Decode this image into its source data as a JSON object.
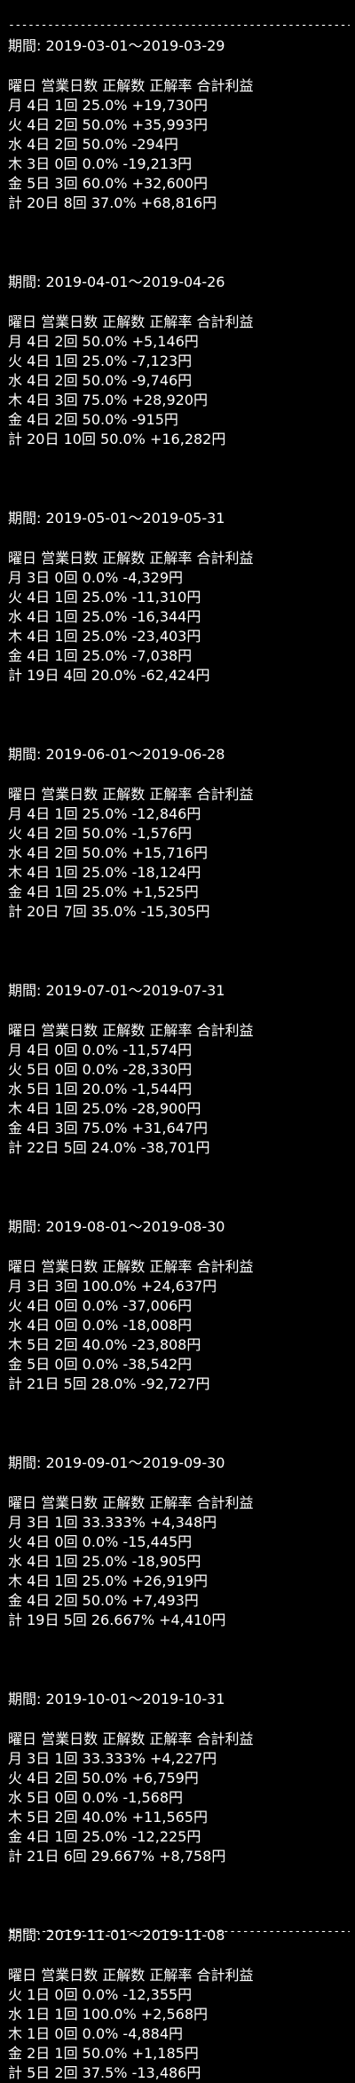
{
  "divider": "------------------------------------------------------",
  "period_label": "期間:",
  "header": [
    "曜日",
    "営業日数",
    "正解数",
    "正解率",
    "合計利益"
  ],
  "blocks": [
    {
      "period": "2019-03-01～2019-03-29",
      "rows": [
        [
          "月",
          "4日",
          "1回",
          "25.0%",
          "+19,730円"
        ],
        [
          "火",
          "4日",
          "2回",
          "50.0%",
          "+35,993円"
        ],
        [
          "水",
          "4日",
          "2回",
          "50.0%",
          "-294円"
        ],
        [
          "木",
          "3日",
          "0回",
          "0.0%",
          "-19,213円"
        ],
        [
          "金",
          "5日",
          "3回",
          "60.0%",
          "+32,600円"
        ],
        [
          "計",
          "20日",
          "8回",
          "37.0%",
          "+68,816円"
        ]
      ]
    },
    {
      "period": "2019-04-01～2019-04-26",
      "rows": [
        [
          "月",
          "4日",
          "2回",
          "50.0%",
          "+5,146円"
        ],
        [
          "火",
          "4日",
          "1回",
          "25.0%",
          "-7,123円"
        ],
        [
          "水",
          "4日",
          "2回",
          "50.0%",
          "-9,746円"
        ],
        [
          "木",
          "4日",
          "3回",
          "75.0%",
          "+28,920円"
        ],
        [
          "金",
          "4日",
          "2回",
          "50.0%",
          "-915円"
        ],
        [
          "計",
          "20日",
          "10回",
          "50.0%",
          "+16,282円"
        ]
      ]
    },
    {
      "period": "2019-05-01～2019-05-31",
      "rows": [
        [
          "月",
          "3日",
          "0回",
          "0.0%",
          "-4,329円"
        ],
        [
          "火",
          "4日",
          "1回",
          "25.0%",
          "-11,310円"
        ],
        [
          "水",
          "4日",
          "1回",
          "25.0%",
          "-16,344円"
        ],
        [
          "木",
          "4日",
          "1回",
          "25.0%",
          "-23,403円"
        ],
        [
          "金",
          "4日",
          "1回",
          "25.0%",
          "-7,038円"
        ],
        [
          "計",
          "19日",
          "4回",
          "20.0%",
          "-62,424円"
        ]
      ]
    },
    {
      "period": "2019-06-01～2019-06-28",
      "rows": [
        [
          "月",
          "4日",
          "1回",
          "25.0%",
          "-12,846円"
        ],
        [
          "火",
          "4日",
          "2回",
          "50.0%",
          "-1,576円"
        ],
        [
          "水",
          "4日",
          "2回",
          "50.0%",
          "+15,716円"
        ],
        [
          "木",
          "4日",
          "1回",
          "25.0%",
          "-18,124円"
        ],
        [
          "金",
          "4日",
          "1回",
          "25.0%",
          "+1,525円"
        ],
        [
          "計",
          "20日",
          "7回",
          "35.0%",
          "-15,305円"
        ]
      ]
    },
    {
      "period": "2019-07-01～2019-07-31",
      "rows": [
        [
          "月",
          "4日",
          "0回",
          "0.0%",
          "-11,574円"
        ],
        [
          "火",
          "5日",
          "0回",
          "0.0%",
          "-28,330円"
        ],
        [
          "水",
          "5日",
          "1回",
          "20.0%",
          "-1,544円"
        ],
        [
          "木",
          "4日",
          "1回",
          "25.0%",
          "-28,900円"
        ],
        [
          "金",
          "4日",
          "3回",
          "75.0%",
          "+31,647円"
        ],
        [
          "計",
          "22日",
          "5回",
          "24.0%",
          "-38,701円"
        ]
      ]
    },
    {
      "period": "2019-08-01～2019-08-30",
      "rows": [
        [
          "月",
          "3日",
          "3回",
          "100.0%",
          "+24,637円"
        ],
        [
          "火",
          "4日",
          "0回",
          "0.0%",
          "-37,006円"
        ],
        [
          "水",
          "4日",
          "0回",
          "0.0%",
          "-18,008円"
        ],
        [
          "木",
          "5日",
          "2回",
          "40.0%",
          "-23,808円"
        ],
        [
          "金",
          "5日",
          "0回",
          "0.0%",
          "-38,542円"
        ],
        [
          "計",
          "21日",
          "5回",
          "28.0%",
          "-92,727円"
        ]
      ]
    },
    {
      "period": "2019-09-01～2019-09-30",
      "rows": [
        [
          "月",
          "3日",
          "1回",
          "33.333%",
          "+4,348円"
        ],
        [
          "火",
          "4日",
          "0回",
          "0.0%",
          "-15,445円"
        ],
        [
          "水",
          "4日",
          "1回",
          "25.0%",
          "-18,905円"
        ],
        [
          "木",
          "4日",
          "1回",
          "25.0%",
          "+26,919円"
        ],
        [
          "金",
          "4日",
          "2回",
          "50.0%",
          "+7,493円"
        ],
        [
          "計",
          "19日",
          "5回",
          "26.667%",
          "+4,410円"
        ]
      ]
    },
    {
      "period": "2019-10-01～2019-10-31",
      "rows": [
        [
          "月",
          "3日",
          "1回",
          "33.333%",
          "+4,227円"
        ],
        [
          "火",
          "4日",
          "2回",
          "50.0%",
          "+6,759円"
        ],
        [
          "水",
          "5日",
          "0回",
          "0.0%",
          "-1,568円"
        ],
        [
          "木",
          "5日",
          "2回",
          "40.0%",
          "+11,565円"
        ],
        [
          "金",
          "4日",
          "1回",
          "25.0%",
          "-12,225円"
        ],
        [
          "計",
          "21日",
          "6回",
          "29.667%",
          "+8,758円"
        ]
      ]
    },
    {
      "period": "2019-11-01～2019-11-08",
      "rows": [
        [
          "火",
          "1日",
          "0回",
          "0.0%",
          "-12,355円"
        ],
        [
          "水",
          "1日",
          "1回",
          "100.0%",
          "+2,568円"
        ],
        [
          "木",
          "1日",
          "0回",
          "0.0%",
          "-4,884円"
        ],
        [
          "金",
          "2日",
          "1回",
          "50.0%",
          "+1,185円"
        ],
        [
          "計",
          "5日",
          "2回",
          "37.5%",
          "-13,486円"
        ]
      ]
    }
  ]
}
